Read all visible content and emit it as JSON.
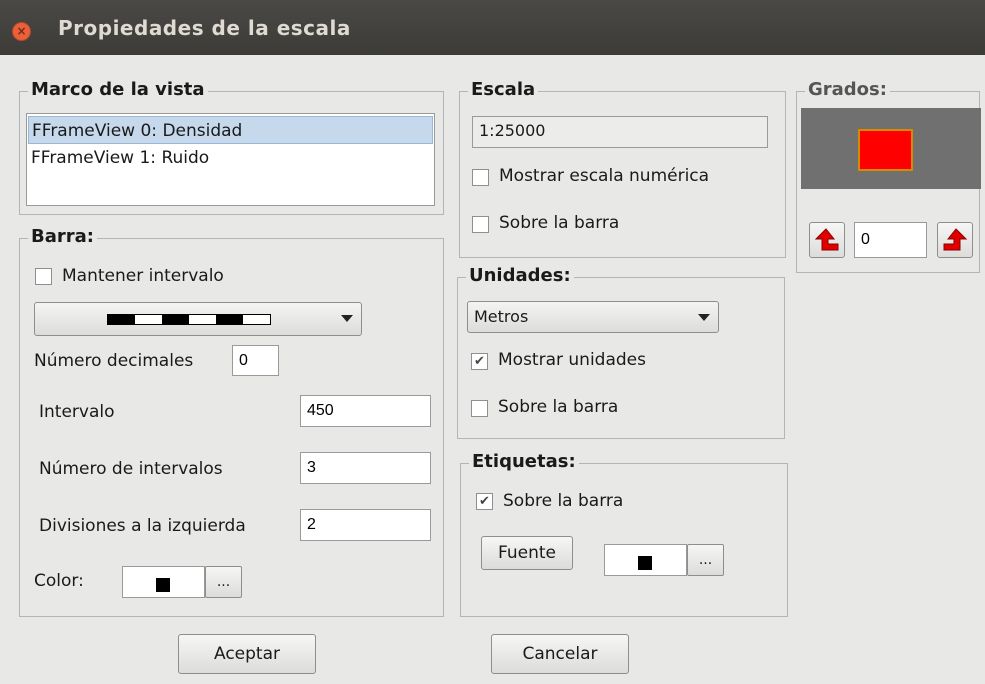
{
  "window": {
    "title": "Propiedades de la escala"
  },
  "marco": {
    "title": "Marco de la vista",
    "items": [
      "FFrameView 0: Densidad",
      "FFrameView 1: Ruido"
    ]
  },
  "barra": {
    "title": "Barra:",
    "mantener_label": "Mantener intervalo",
    "decimales_label": "Número decimales",
    "decimales_value": "0",
    "intervalo_label": "Intervalo",
    "intervalo_value": "450",
    "num_intervalos_label": "Número de intervalos",
    "num_intervalos_value": "3",
    "divisiones_label": "Divisiones a la izquierda",
    "divisiones_value": "2",
    "color_label": "Color:",
    "color_button": "...",
    "color_value": "#000000"
  },
  "escala": {
    "title": "Escala",
    "value": "1:25000",
    "mostrar_label": "Mostrar escala numérica",
    "sobre_label": "Sobre la barra"
  },
  "unidades": {
    "title": "Unidades:",
    "selected": "Metros",
    "mostrar_label": "Mostrar unidades",
    "mostrar_checked": true,
    "sobre_label": "Sobre la barra"
  },
  "etiquetas": {
    "title": "Etiquetas:",
    "sobre_label": "Sobre la barra",
    "sobre_checked": true,
    "fuente_button": "Fuente",
    "color_button": "...",
    "color_value": "#000000"
  },
  "grados": {
    "title": "Grados:",
    "value": "0",
    "preview_color": "#ff0000",
    "preview_bg": "#707070",
    "icons": [
      "rotate-left-arrow-icon",
      "rotate-right-arrow-icon"
    ]
  },
  "buttons": {
    "accept": "Aceptar",
    "cancel": "Cancelar"
  },
  "colors": {
    "accent_red": "#e00000",
    "selection": "#c6d8eb"
  }
}
